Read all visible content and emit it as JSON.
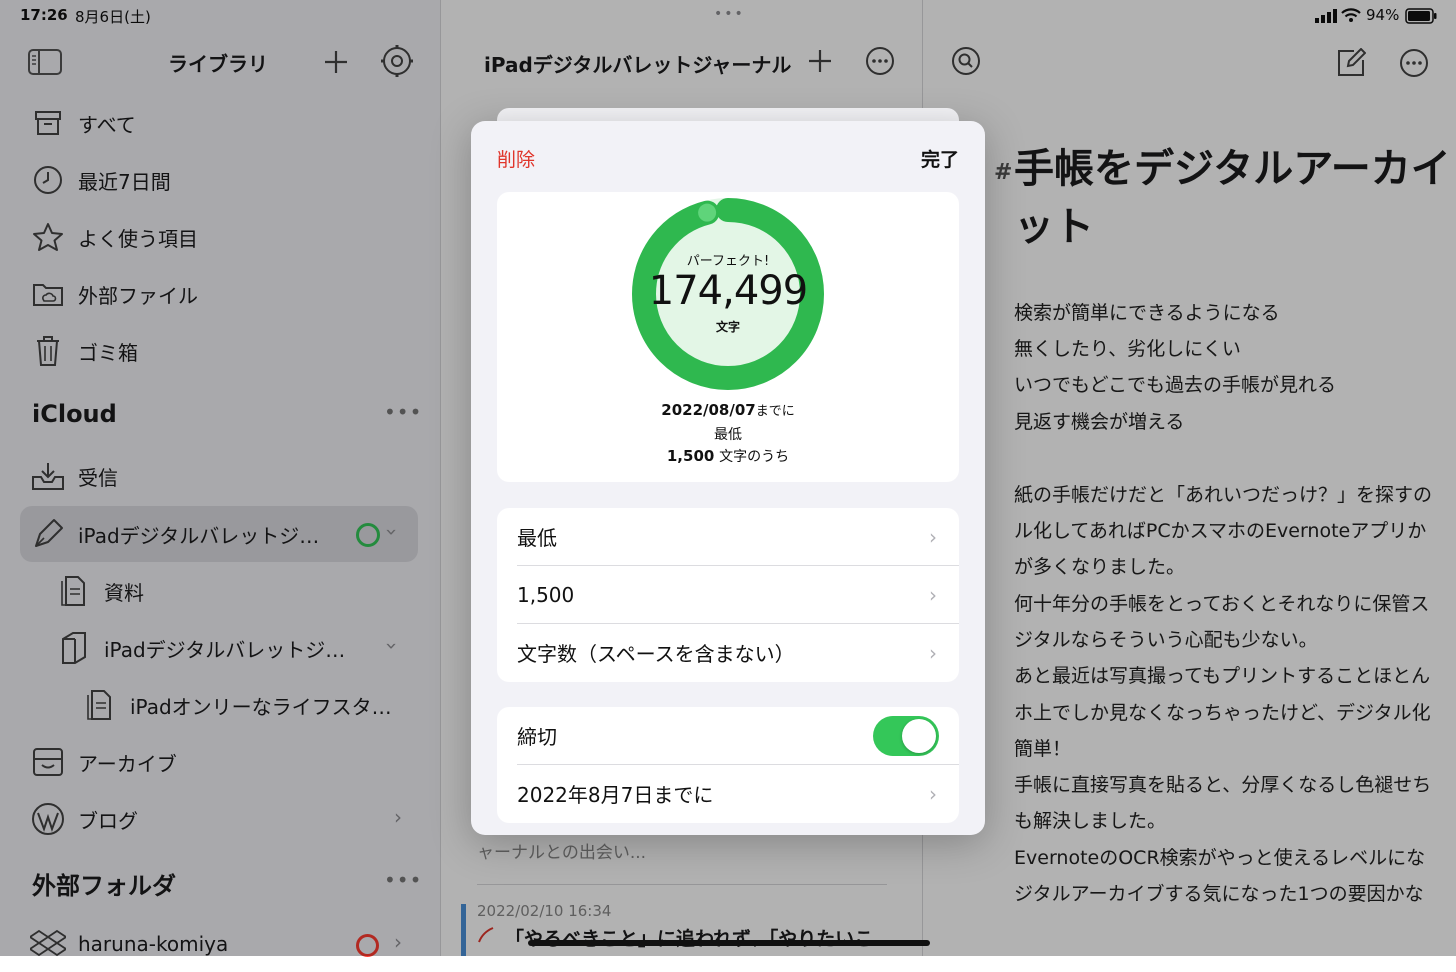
{
  "status": {
    "time": "17:26",
    "date": "8月6日(土)",
    "battery": "94%"
  },
  "sidebar": {
    "title": "ライブラリ",
    "items": [
      {
        "label": "すべて"
      },
      {
        "label": "最近7日間"
      },
      {
        "label": "よく使う項目"
      },
      {
        "label": "外部ファイル"
      },
      {
        "label": "ゴミ箱"
      }
    ],
    "icloud": {
      "title": "iCloud",
      "items": [
        {
          "label": "受信"
        },
        {
          "label": "iPadデジタルバレットジ…"
        },
        {
          "label": "資料"
        },
        {
          "label": "iPadデジタルバレットジ…"
        },
        {
          "label": "iPadオンリーなライフスタ…"
        },
        {
          "label": "アーカイブ"
        },
        {
          "label": "ブログ"
        }
      ]
    },
    "external": {
      "title": "外部フォルダ",
      "items": [
        {
          "label": "haruna-komiya"
        }
      ]
    }
  },
  "sheet_list": {
    "title": "iPadデジタルバレットジャーナル",
    "snippet": "ャーナルとの出会い...",
    "date": "2022/02/10 16:34",
    "title2": "「やるべきこと」に追われず、「やりたいこ"
  },
  "editor": {
    "hash": "#",
    "title": "手帳をデジタルアーカイブするメリット",
    "title_line1": "手帳をデジタルアーカイ",
    "title_line2": "ット",
    "lines": [
      "検索が簡単にできるようになる",
      "無くしたり、劣化しにくい",
      "いつでもどこでも過去の手帳が見れる",
      "見返す機会が増える",
      "紙の手帳だけだと「あれいつだっけ？」を探すの",
      "ル化してあればPCかスマホのEvernoteアプリか",
      "が多くなりました。",
      "何十年分の手帳をとっておくとそれなりに保管ス",
      "ジタルならそういう心配も少ない。",
      "あと最近は写真撮ってもプリントすることほとん",
      "ホ上でしか見なくなっちゃったけど、デジタル化",
      "簡単！",
      "手帳に直接写真を貼ると、分厚くなるし色褪せち",
      "も解決しました。",
      "EvernoteのOCR検索がやっと使えるレベルにな",
      "ジタルアーカイブする気になった1つの要因かな"
    ]
  },
  "modal": {
    "delete_label": "削除",
    "done_label": "完了",
    "progress": {
      "perfect_label": "パーフェクト!",
      "count": "174,499",
      "unit": "文字",
      "deadline_date": "2022/08/07",
      "deadline_suffix": "までに",
      "min_label": "最低",
      "target": "1,500",
      "target_suffix": "文字のうち",
      "fraction": 0.96
    },
    "goal_rows": [
      {
        "label": "最低"
      },
      {
        "label": "1,500"
      },
      {
        "label": "文字数（スペースを含まない）"
      }
    ],
    "deadline_toggle_label": "締切",
    "deadline_toggle_on": true,
    "deadline_row": "2022年8月7日までに"
  },
  "colors": {
    "accent_green": "#34c759",
    "ring_green": "#2fb84f",
    "delete_red": "#e0352b",
    "record_red": "#ff3b30"
  }
}
